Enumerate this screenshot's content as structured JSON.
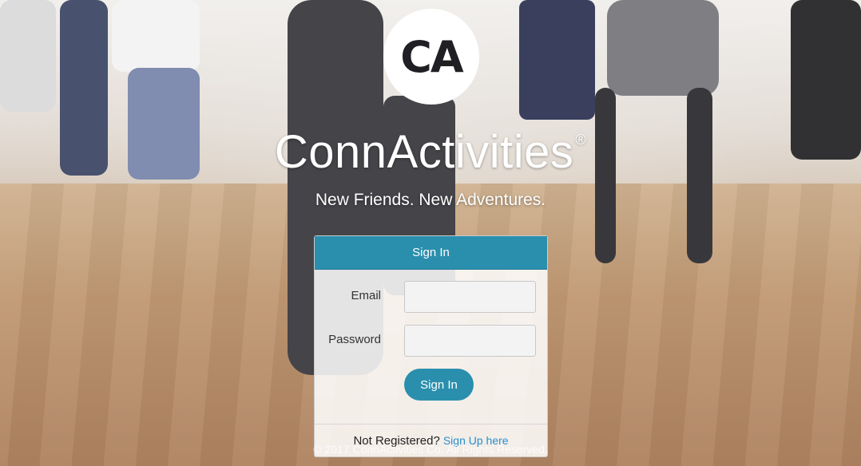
{
  "logo": {
    "text": "CA"
  },
  "brand": {
    "name": "ConnActivities",
    "registered": "®"
  },
  "tagline": "New Friends. New Adventures.",
  "signin": {
    "title": "Sign In",
    "email_label": "Email",
    "email_value": "",
    "password_label": "Password",
    "password_value": "",
    "submit_label": "Sign In",
    "not_registered": "Not Registered?",
    "signup_link": "Sign Up here"
  },
  "footer": {
    "copyright": "© 2017 ConnActivities Co. All Rights Reserved."
  },
  "colors": {
    "accent": "#2a8fad",
    "link": "#2a8fcd"
  }
}
